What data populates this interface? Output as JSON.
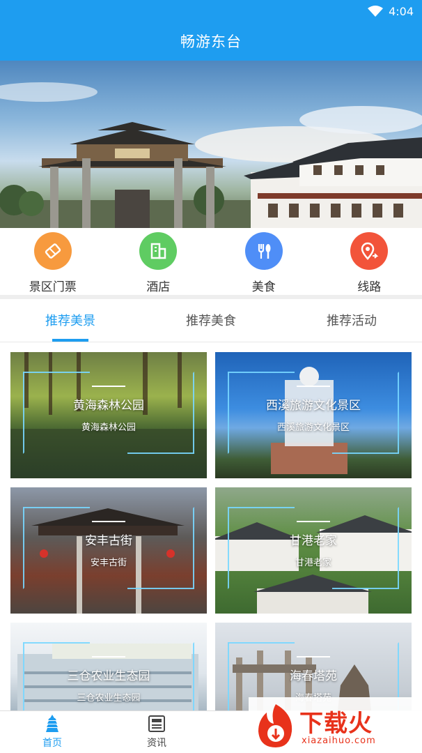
{
  "status": {
    "time": "4:04"
  },
  "app": {
    "title": "畅游东台"
  },
  "categories": [
    {
      "label": "景区门票",
      "icon": "ticket-icon",
      "color": "#f79a3e"
    },
    {
      "label": "酒店",
      "icon": "hotel-icon",
      "color": "#5fcc62"
    },
    {
      "label": "美食",
      "icon": "food-icon",
      "color": "#4f8ef7"
    },
    {
      "label": "线路",
      "icon": "route-icon",
      "color": "#f2543a"
    }
  ],
  "tabs": [
    {
      "label": "推荐美景",
      "active": true
    },
    {
      "label": "推荐美食",
      "active": false
    },
    {
      "label": "推荐活动",
      "active": false
    }
  ],
  "cards": [
    {
      "title": "黄海森林公园",
      "subtitle": "黄海森林公园"
    },
    {
      "title": "西溪旅游文化景区",
      "subtitle": "西溪旅游文化景区"
    },
    {
      "title": "安丰古街",
      "subtitle": "安丰古街"
    },
    {
      "title": "甘港老家",
      "subtitle": "甘港老家"
    },
    {
      "title": "三仓农业生态园",
      "subtitle": "三仓农业生态园"
    },
    {
      "title": "海春塔苑",
      "subtitle": "海春塔苑"
    }
  ],
  "bottom_nav": [
    {
      "label": "首页",
      "icon": "pagoda-home-icon",
      "active": true
    },
    {
      "label": "资讯",
      "icon": "news-icon",
      "active": false
    }
  ],
  "watermark": {
    "text": "下载火",
    "url": "xiazaihuo.com"
  },
  "colors": {
    "primary": "#1e9df0"
  }
}
